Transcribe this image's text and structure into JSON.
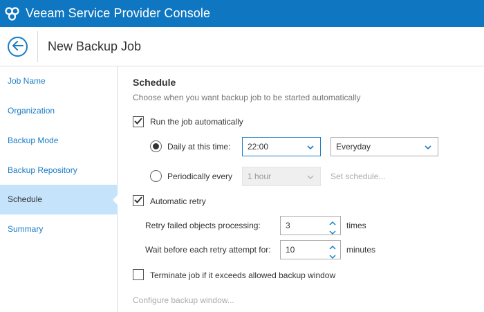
{
  "app": {
    "title": "Veeam Service Provider Console"
  },
  "page": {
    "title": "New Backup Job"
  },
  "sidebar": {
    "items": [
      {
        "label": "Job Name"
      },
      {
        "label": "Organization"
      },
      {
        "label": "Backup Mode"
      },
      {
        "label": "Backup Repository"
      },
      {
        "label": "Schedule"
      },
      {
        "label": "Summary"
      }
    ],
    "active": "Schedule"
  },
  "schedule": {
    "title": "Schedule",
    "subtitle": "Choose when you want backup job to be started automatically",
    "run_automatically": {
      "label": "Run the job automatically",
      "checked": true
    },
    "daily": {
      "label": "Daily at this time:",
      "selected": true,
      "time": "22:00",
      "days": "Everyday"
    },
    "periodically": {
      "label": "Periodically every",
      "selected": false,
      "interval": "1 hour",
      "set_schedule": "Set schedule..."
    },
    "automatic_retry": {
      "label": "Automatic retry",
      "checked": true,
      "retry_label": "Retry failed objects processing:",
      "retry_value": "3",
      "retry_unit": "times",
      "wait_label": "Wait before each retry attempt for:",
      "wait_value": "10",
      "wait_unit": "minutes"
    },
    "terminate": {
      "label": "Terminate job if it exceeds allowed backup window",
      "checked": false
    },
    "configure_window": "Configure backup window..."
  },
  "colors": {
    "brand": "#0f76c1",
    "active_bg": "#c5e4fb",
    "link": "#1a7cc5"
  }
}
